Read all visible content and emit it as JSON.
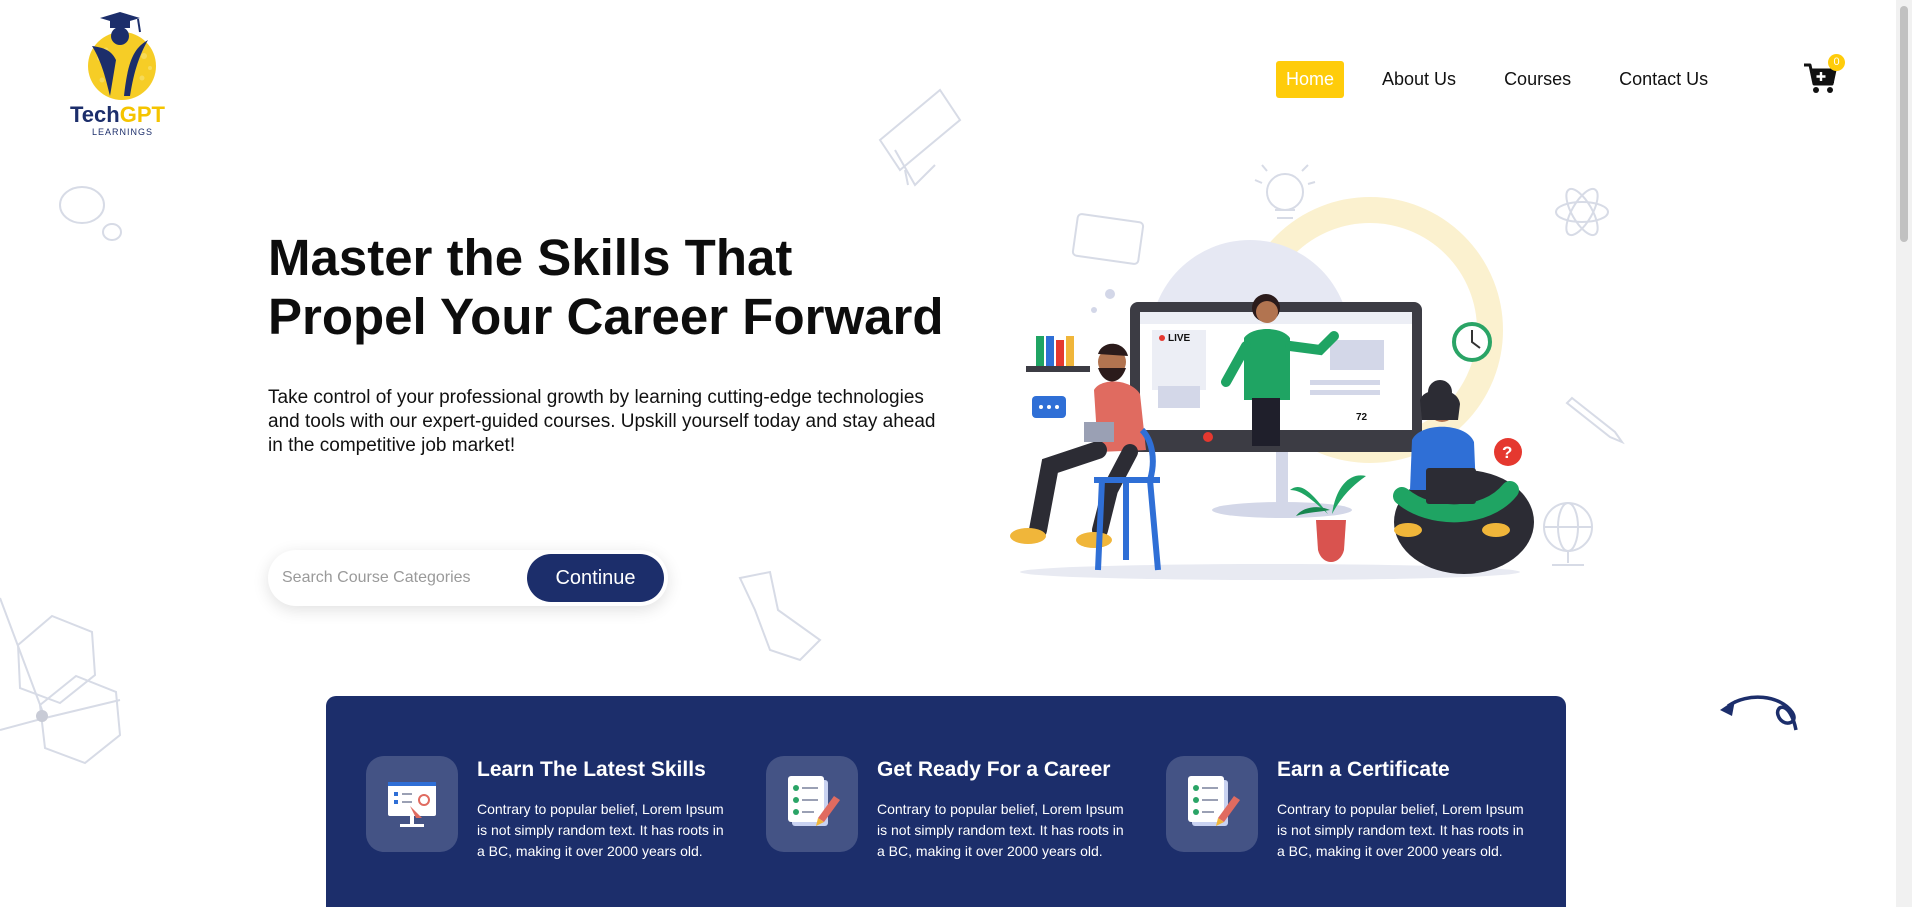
{
  "brand": {
    "name_part1": "Tech",
    "name_part2": "GPT",
    "tagline": "LEARNINGS"
  },
  "nav": {
    "items": [
      {
        "label": "Home",
        "active": true
      },
      {
        "label": "About Us",
        "active": false
      },
      {
        "label": "Courses",
        "active": false
      },
      {
        "label": "Contact Us",
        "active": false
      }
    ],
    "cart_count": "0"
  },
  "hero": {
    "title_line1": "Master the Skills That",
    "title_line2": "Propel Your Career Forward",
    "subtitle": "Take control of your professional growth by learning cutting-edge technologies and tools with our expert-guided courses. Upskill yourself today and stay ahead in the competitive job market!",
    "search_placeholder": "Search Course Categories",
    "search_button": "Continue",
    "illustration_live_label": "LIVE",
    "illustration_viewer_count": "72"
  },
  "features": [
    {
      "title": "Learn The Latest Skills",
      "text": "Contrary to popular belief, Lorem Ipsum is not simply random text. It has roots in a BC, making it over 2000 years old.",
      "icon": "presentation-board-icon"
    },
    {
      "title": "Get Ready For a Career",
      "text": "Contrary to popular belief, Lorem Ipsum is not simply random text. It has roots in a BC, making it over 2000 years old.",
      "icon": "checklist-icon"
    },
    {
      "title": "Earn a Certificate",
      "text": "Contrary to popular belief, Lorem Ipsum is not simply random text. It has roots in a BC, making it over 2000 years old.",
      "icon": "certificate-icon"
    }
  ],
  "colors": {
    "primary": "#1c2e6b",
    "accent": "#ffcc0a",
    "text": "#111111",
    "background": "#ffffff"
  }
}
